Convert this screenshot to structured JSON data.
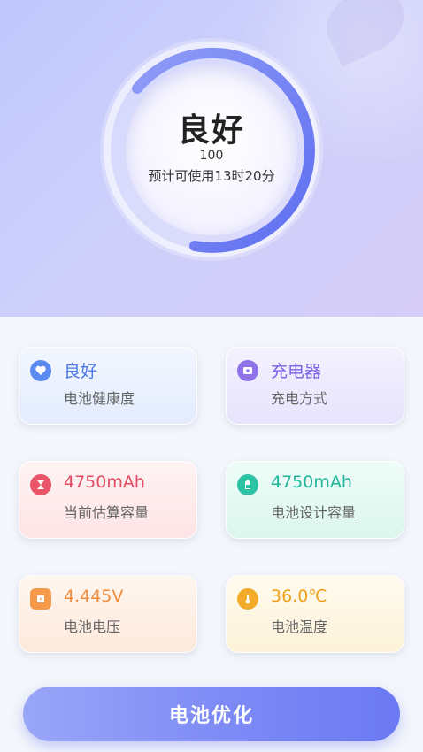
{
  "gauge": {
    "status": "良好",
    "score": "100",
    "remaining": "预计可使用13时20分",
    "level": 1.0,
    "accent": "#6f7cf3"
  },
  "cards": [
    {
      "value": "良好",
      "label": "电池健康度",
      "icon": "heart-icon",
      "value_color": "#4b7ae8",
      "icon_color": "#5b8bf0"
    },
    {
      "value": "充电器",
      "label": "充电方式",
      "icon": "plus-box-icon",
      "value_color": "#7a62e0",
      "icon_color": "#8e72ea"
    },
    {
      "value": "4750mAh",
      "label": "当前估算容量",
      "icon": "hourglass-icon",
      "value_color": "#e24d62",
      "icon_color": "#ea5569"
    },
    {
      "value": "4750mAh",
      "label": "电池设计容量",
      "icon": "battery-icon",
      "value_color": "#22b59a",
      "icon_color": "#2cc3a5"
    },
    {
      "value": "4.445V",
      "label": "电池电压",
      "icon": "voltage-icon",
      "value_color": "#f08b3c",
      "icon_color": "#f59a4b"
    },
    {
      "value": "36.0℃",
      "label": "电池温度",
      "icon": "thermometer-icon",
      "value_color": "#eea01c",
      "icon_color": "#f2ac2a"
    }
  ],
  "button": {
    "label": "电池优化"
  }
}
